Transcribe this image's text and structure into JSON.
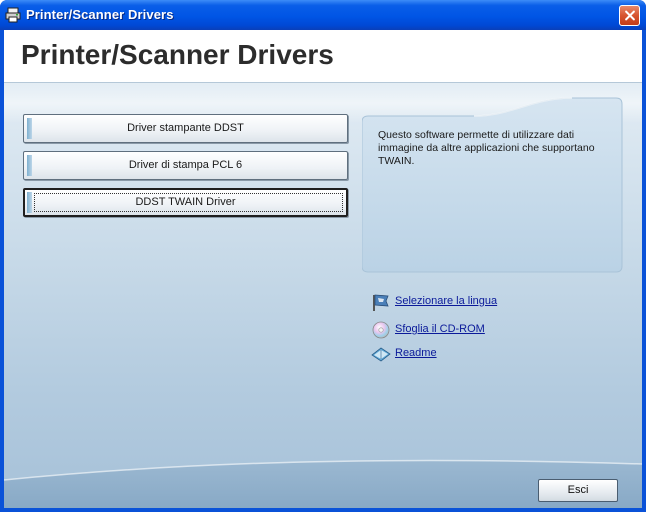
{
  "window": {
    "title": "Printer/Scanner Drivers"
  },
  "header": {
    "title": "Printer/Scanner Drivers"
  },
  "drivers": [
    {
      "label": "Driver stampante DDST",
      "selected": false
    },
    {
      "label": "Driver di stampa PCL 6",
      "selected": false
    },
    {
      "label": "DDST TWAIN Driver",
      "selected": true
    }
  ],
  "description": "Questo software permette di utilizzare dati immagine da altre applicazioni che supportano TWAIN.",
  "links": {
    "language": "Selezionare la lingua",
    "browse_cd": "Sfoglia il CD-ROM",
    "readme": "Readme"
  },
  "exit_label": "Esci",
  "colors": {
    "titlebar": "#0055e5",
    "close": "#d7542f",
    "link": "#0b1a9a"
  }
}
